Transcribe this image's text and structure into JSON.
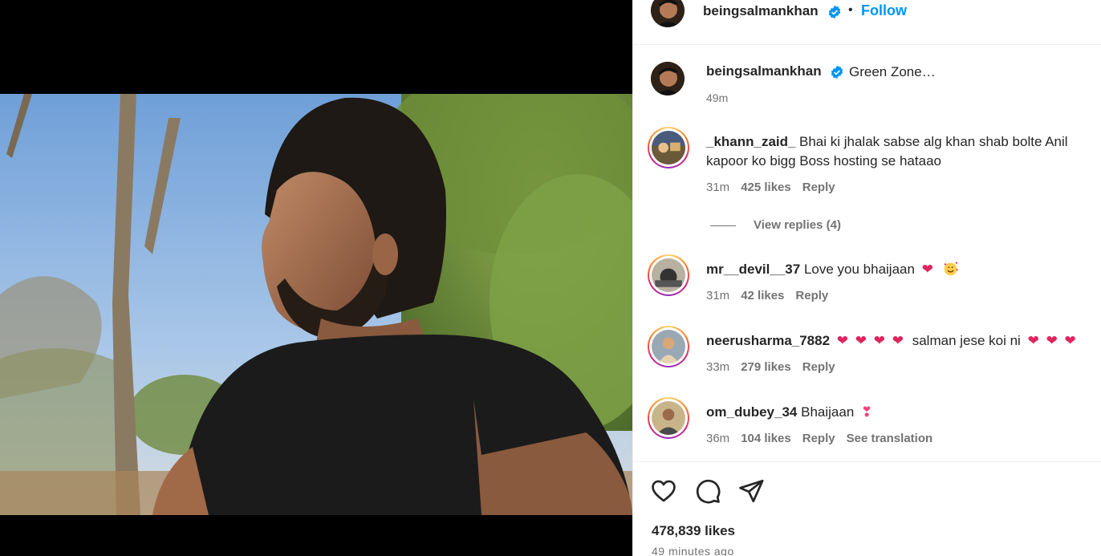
{
  "post": {
    "author": "beingsalmankhan",
    "follow_label": "Follow",
    "separator": "•",
    "caption": "Green Zone…",
    "caption_time": "49m",
    "likes": "478,839 likes",
    "time_ago": "49 minutes ago"
  },
  "comments": [
    {
      "user": "_khann_zaid_",
      "text": "Bhai ki jhalak sabse alg khan shab bolte Anil kapoor ko bigg Boss hosting se hataao",
      "time": "31m",
      "likes": "425 likes",
      "reply": "Reply",
      "view_replies": "View replies (4)"
    },
    {
      "user": "mr__devil__37",
      "text": "Love you bhaijaan",
      "time": "31m",
      "likes": "42 likes",
      "reply": "Reply"
    },
    {
      "user": "neerusharma_7882",
      "text": "salman jese koi ni",
      "time": "33m",
      "likes": "279 likes",
      "reply": "Reply"
    },
    {
      "user": "om_dubey_34",
      "text": "Bhaijaan",
      "time": "36m",
      "likes": "104 likes",
      "reply": "Reply",
      "translation": "See translation"
    }
  ],
  "icons": {
    "like": "heart-outline-icon",
    "comment": "comment-bubble-icon",
    "share": "paper-plane-icon",
    "verified": "verified-badge-icon"
  },
  "colors": {
    "link_blue": "#0095f6",
    "verified_blue": "#0095f6",
    "heart_red": "#e0245e",
    "muted_text": "#737373"
  }
}
